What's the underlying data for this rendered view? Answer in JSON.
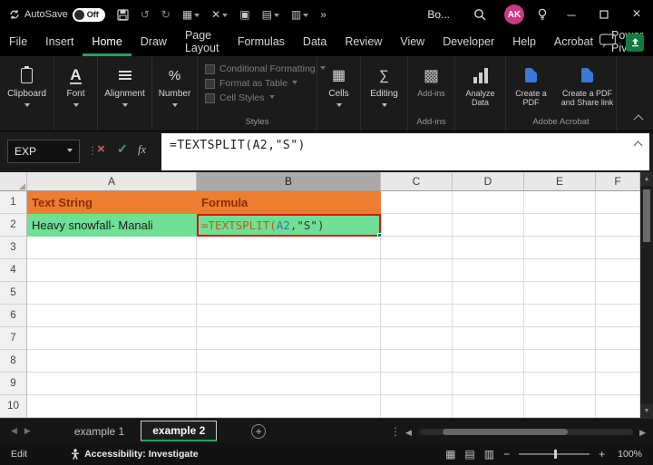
{
  "colors": {
    "accent-green": "#1ea35c",
    "title-green": "#107c41",
    "cell-orange": "#ed7d31",
    "cell-green": "#6fdf96",
    "formula-func": "#c55a11",
    "formula-ref": "#2e75b6",
    "edit-border-red": "#e01010",
    "avatar-pink": "#cb3a83"
  },
  "titlebar": {
    "autosave_label": "AutoSave",
    "autosave_state": "Off",
    "doc_title": "Bo...",
    "avatar_initials": "AK"
  },
  "icons": {
    "undo": "↺",
    "redo": "↻",
    "qat": [
      "▦",
      "✕",
      "▣",
      "▤",
      "▥"
    ],
    "more": "»",
    "minimize": "─",
    "close": "×",
    "cancel": "×",
    "check": "✓",
    "dots": "⋮",
    "select_all": "◢",
    "scroll_up": "▲",
    "scroll_down": "▼",
    "scroll_left": "◀",
    "scroll_right": "▶",
    "view_normal": "▦",
    "view_layout": "▤",
    "view_break": "▥",
    "font_letter": "A",
    "percent": "%",
    "cells": "▦",
    "editing": "∑",
    "addins": "▩",
    "zoom_out": "−",
    "zoom_in": "+",
    "plus": "+"
  },
  "menubar": {
    "items": [
      "File",
      "Insert",
      "Home",
      "Draw",
      "Page Layout",
      "Formulas",
      "Data",
      "Review",
      "View",
      "Developer",
      "Help",
      "Acrobat",
      "Power Pivot"
    ]
  },
  "ribbon": {
    "clipboard": "Clipboard",
    "font": "Font",
    "alignment": "Alignment",
    "number": "Number",
    "styles_items": [
      "Conditional Formatting",
      "Format as Table",
      "Cell Styles"
    ],
    "styles_label": "Styles",
    "cells": "Cells",
    "editing": "Editing",
    "addins": "Add-ins",
    "addins_group": "Add-ins",
    "analyze_data": "Analyze Data",
    "create_pdf": "Create a PDF",
    "create_pdf_share": "Create a PDF and Share link",
    "acrobat_group": "Adobe Acrobat"
  },
  "formula_bar": {
    "name_box": "EXP",
    "fx": "fx",
    "formula": "=TEXTSPLIT(A2,\"S\")"
  },
  "grid": {
    "columns": [
      "A",
      "B",
      "C",
      "D",
      "E",
      "F"
    ],
    "rows": [
      "1",
      "2",
      "3",
      "4",
      "5",
      "6",
      "7",
      "8",
      "9",
      "10"
    ],
    "a1": "Text String",
    "b1": "Formula",
    "a2": "Heavy snowfall- Manali",
    "b2": {
      "prefix": "=TEXTSPLIT(",
      "ref": "A2",
      "suffix": ",\"S\")"
    }
  },
  "sheet_tabs": {
    "tab1": "example 1",
    "tab2": "example 2"
  },
  "status_bar": {
    "mode": "Edit",
    "accessibility": "Accessibility: Investigate",
    "zoom_level": "100%"
  }
}
